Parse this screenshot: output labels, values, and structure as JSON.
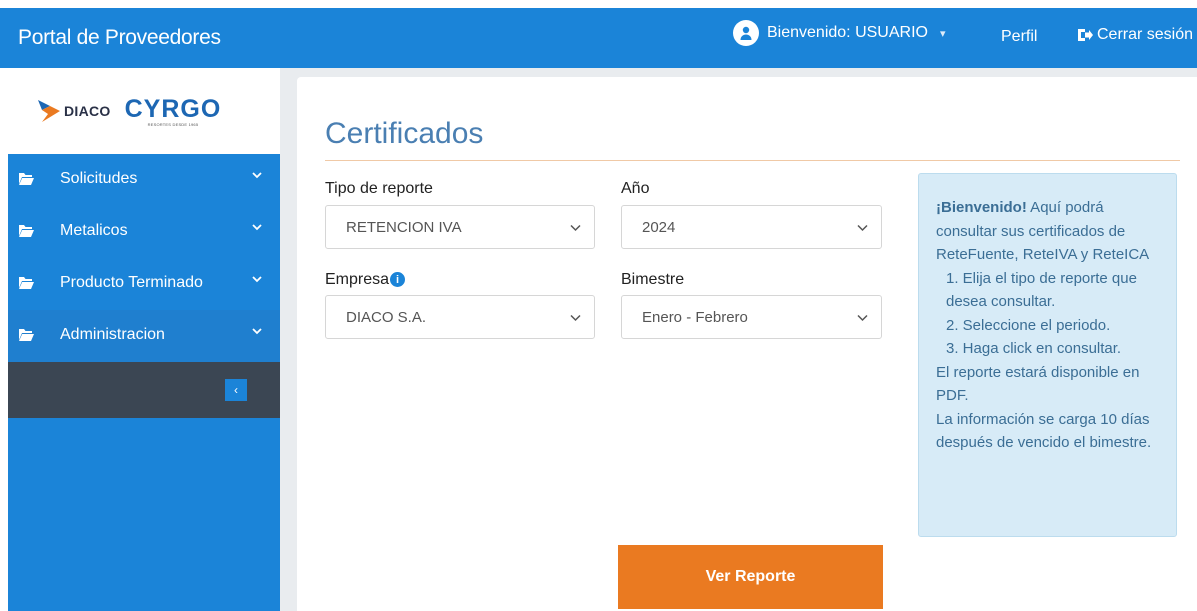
{
  "header": {
    "brand": "Portal de Proveedores",
    "welcome": "Bienvenido: USUARIO",
    "profile": "Perfil",
    "logout": "Cerrar sesión"
  },
  "logos": {
    "diaco": "DIACO",
    "cyrgo": "CYRGO",
    "cyrgo_tagline": "RESORTES DESDE 1965"
  },
  "sidebar": {
    "items": [
      {
        "label": "Solicitudes",
        "icon": "folder-icon"
      },
      {
        "label": "Metalicos",
        "icon": "folder-icon"
      },
      {
        "label": "Producto Terminado",
        "icon": "folder-icon"
      },
      {
        "label": "Administracion",
        "icon": "folder-icon"
      }
    ],
    "collapse_label": "‹"
  },
  "main": {
    "title": "Certificados",
    "report_type": {
      "label": "Tipo de reporte",
      "value": "RETENCION IVA"
    },
    "year": {
      "label": "Año",
      "value": "2024"
    },
    "company": {
      "label": "Empresa",
      "value": "DIACO S.A.",
      "info": "i"
    },
    "period": {
      "label": "Bimestre",
      "value": "Enero - Febrero"
    },
    "submit": "Ver Reporte"
  },
  "info": {
    "welcome_bold": "¡Bienvenido!",
    "intro": " Aquí podrá consultar sus certificados de ReteFuente, ReteIVA y ReteICA",
    "step1": "1. Elija el tipo de reporte que desea consultar.",
    "step2": "2. Seleccione el periodo.",
    "step3": "3. Haga click en consultar.",
    "pdf_note": "El reporte estará disponible en PDF.",
    "load_note": "La información se carga 10 días después de vencido el bimestre."
  },
  "colors": {
    "primary": "#1b84d8",
    "accent": "#ea7a21",
    "dark": "#3b4653",
    "info_bg": "#d7ebf7"
  }
}
